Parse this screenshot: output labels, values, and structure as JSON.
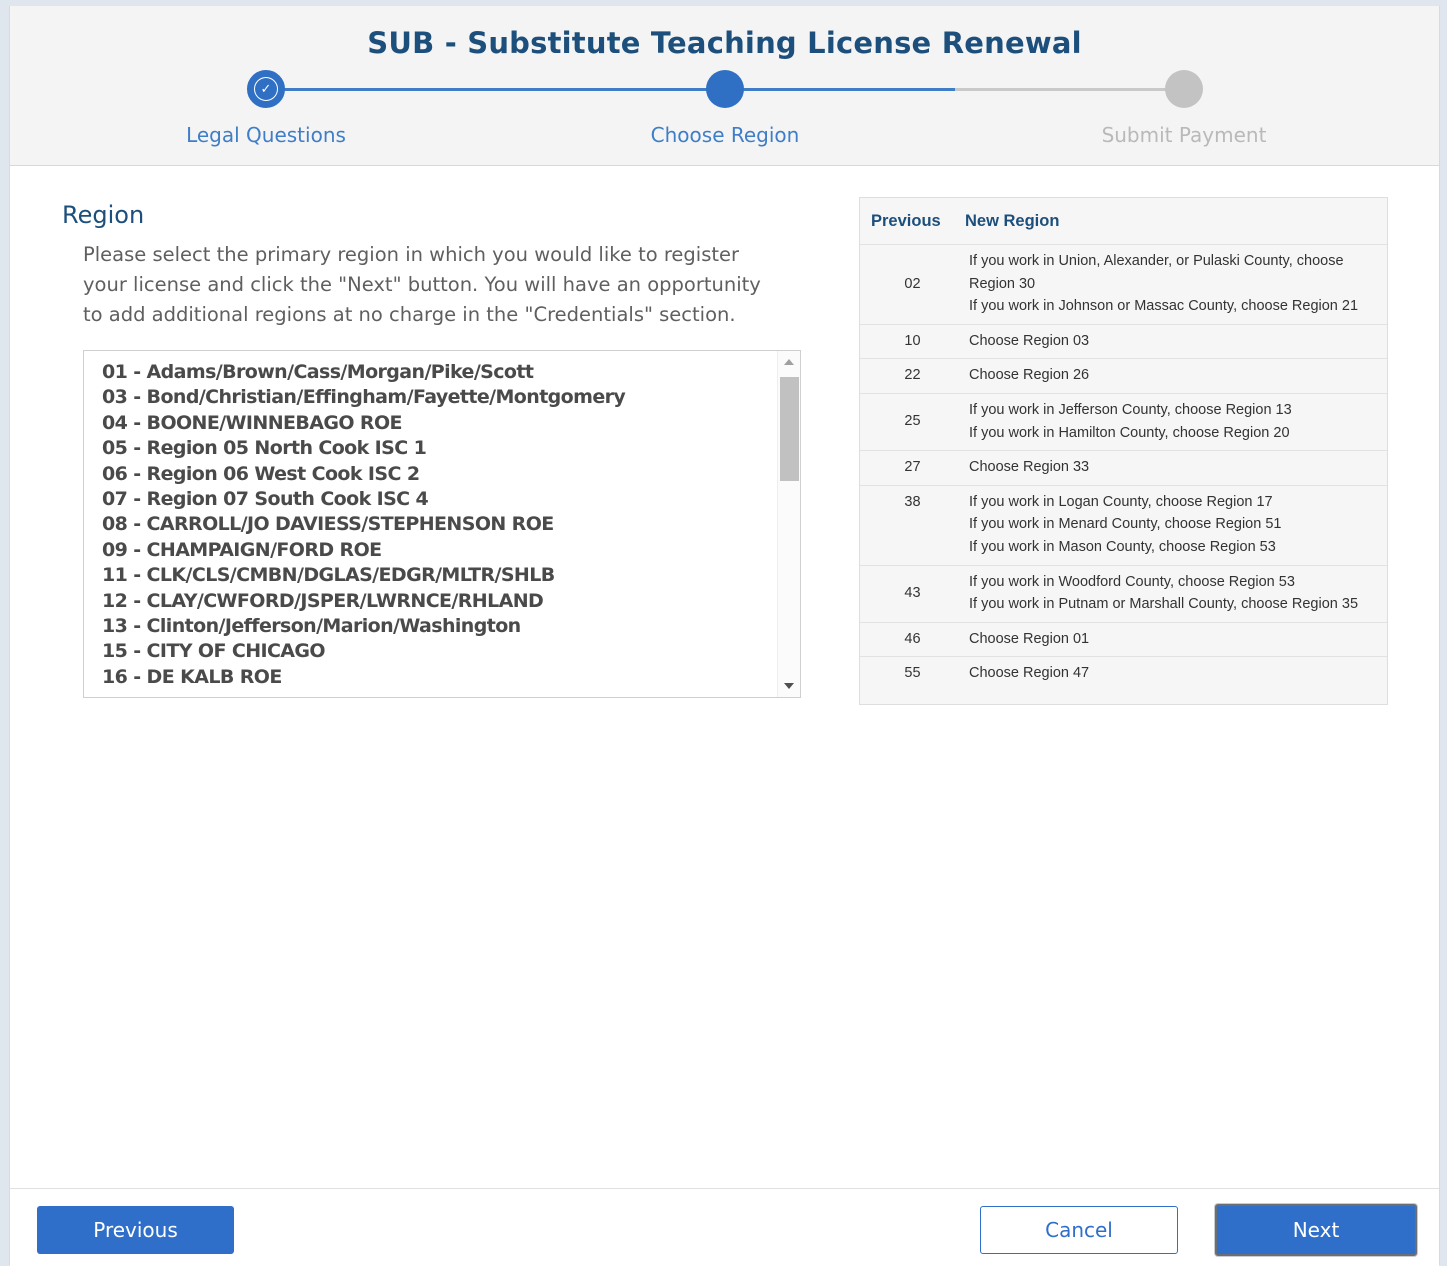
{
  "header": {
    "title": "SUB - Substitute Teaching License Renewal",
    "steps": [
      {
        "label": "Legal Questions",
        "status": "complete"
      },
      {
        "label": "Choose Region",
        "status": "current"
      },
      {
        "label": "Submit Payment",
        "status": "pending"
      }
    ]
  },
  "region": {
    "title": "Region",
    "instructions": "Please select the primary region in which you would like to register your license and click the \"Next\" button. You will have an opportunity to add additional regions at no charge in the \"Credentials\" section.",
    "options": [
      "01 - Adams/Brown/Cass/Morgan/Pike/Scott",
      "03 - Bond/Christian/Effingham/Fayette/Montgomery",
      "04 - BOONE/WINNEBAGO ROE",
      "05 - Region 05 North Cook ISC 1",
      "06 - Region 06 West Cook ISC 2",
      "07 - Region 07 South Cook ISC 4",
      "08 - CARROLL/JO DAVIESS/STEPHENSON ROE",
      "09 - CHAMPAIGN/FORD ROE",
      "11 - CLK/CLS/CMBN/DGLAS/EDGR/MLTR/SHLB",
      "12 - CLAY/CWFORD/JSPER/LWRNCE/RHLAND",
      "13 - Clinton/Jefferson/Marion/Washington",
      "15 - CITY OF CHICAGO",
      "16 - DE KALB ROE"
    ]
  },
  "mapping_table": {
    "headers": {
      "previous": "Previous",
      "new_region": "New Region"
    },
    "rows": [
      {
        "previous": "02",
        "lines": [
          "If you work in Union, Alexander, or Pulaski County, choose Region 30",
          "If you work in Johnson or Massac County, choose Region 21"
        ]
      },
      {
        "previous": "10",
        "lines": [
          "Choose Region 03"
        ]
      },
      {
        "previous": "22",
        "lines": [
          "Choose Region 26"
        ]
      },
      {
        "previous": "25",
        "lines": [
          "If you work in Jefferson County, choose Region 13",
          "If you work in Hamilton County, choose Region 20"
        ]
      },
      {
        "previous": "27",
        "lines": [
          "Choose Region 33"
        ]
      },
      {
        "previous": "38",
        "lines": [
          "If you work in Logan County, choose Region 17",
          "If you work in Menard County, choose Region 51",
          "If you work in Mason County, choose Region 53"
        ]
      },
      {
        "previous": "43",
        "lines": [
          "If you work in Woodford County, choose Region 53",
          "If you work in Putnam or Marshall County, choose Region 35"
        ]
      },
      {
        "previous": "46",
        "lines": [
          "Choose Region 01"
        ]
      },
      {
        "previous": "55",
        "lines": [
          "Choose Region 47"
        ]
      }
    ]
  },
  "footer": {
    "previous_label": "Previous",
    "cancel_label": "Cancel",
    "next_label": "Next"
  },
  "colors": {
    "primary": "#2f6fc9",
    "heading": "#1d4f7c",
    "inactive": "#c3c3c3"
  }
}
